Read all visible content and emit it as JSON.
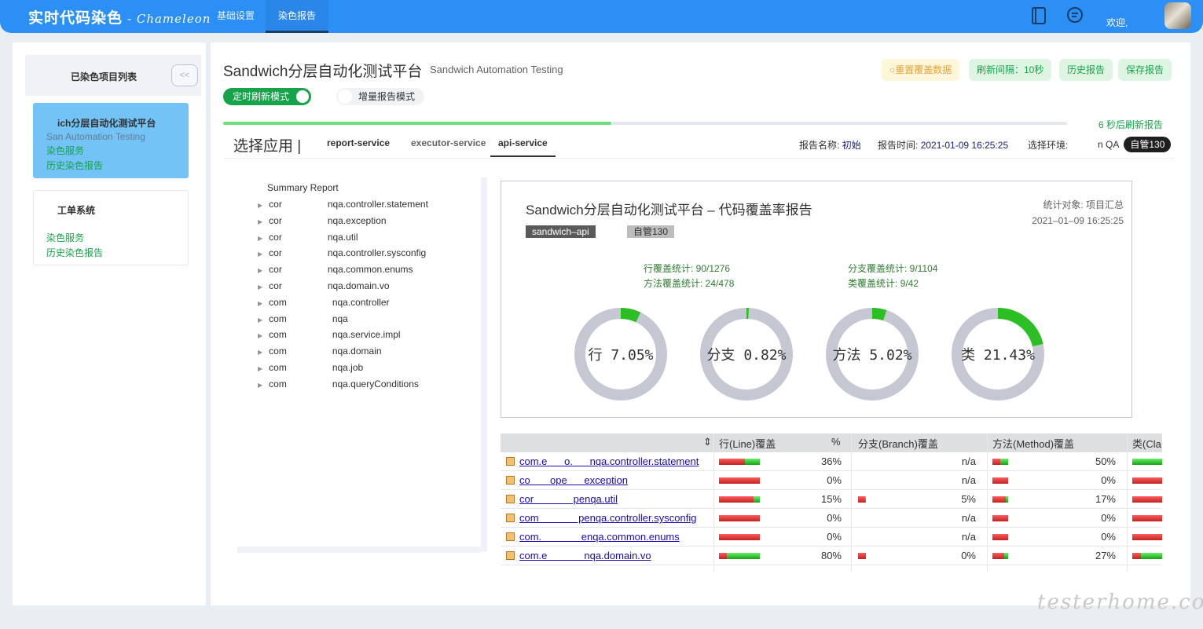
{
  "header": {
    "title": "实时代码染色",
    "subtitle": "- Chameleon",
    "nav": [
      "基础设置",
      "染色报告"
    ],
    "active_nav": "染色报告",
    "welcome": "欢迎,"
  },
  "sidebar": {
    "title": "已染色项目列表",
    "collapse_label": "<<",
    "projects": [
      {
        "name": "Sandwich分层自动化测试平台",
        "name_visible": "ich分层自动化测试平台",
        "en": "Sandwich Automation Testing",
        "en_visible": "San      Automation Testing",
        "links": [
          "染色服务",
          "历史染色报告"
        ],
        "active": true
      },
      {
        "name": "工单系统",
        "en": "",
        "links": [
          "染色服务",
          "历史染色报告"
        ],
        "active": false
      }
    ]
  },
  "main": {
    "title": "Sandwich分层自动化测试平台",
    "subtitle": "Sandwich Automation Testing",
    "buttons": {
      "reset": "重置覆盖数据",
      "interval": "刷新间隔：10秒",
      "history": "历史报告",
      "save": "保存报告"
    },
    "switches": {
      "timed": "定时刷新模式",
      "incremental": "增量报告模式"
    },
    "refresh_progress": 0.46,
    "refresh_note": "6 秒后刷新报告"
  },
  "appbar": {
    "label": "选择应用 |",
    "tabs": [
      "report-service",
      "executor-service",
      "api-service"
    ],
    "active_tab": "api-service",
    "report_name_label": "报告名称:",
    "report_name": "初始",
    "report_time_label": "报告时间:",
    "report_time": "2021-01-09 16:25:25",
    "env_label": "选择环境:",
    "env_options": [
      "n QA",
      "自管130"
    ],
    "env_selected": "自管130"
  },
  "tree": {
    "summary": "Summary Report",
    "items": [
      {
        "prefix": "cor",
        "suffix": "nqa.controller.statement"
      },
      {
        "prefix": "cor",
        "suffix": "nqa.exception"
      },
      {
        "prefix": "cor",
        "suffix": "nqa.util"
      },
      {
        "prefix": "cor",
        "suffix": "nqa.controller.sysconfig"
      },
      {
        "prefix": "cor",
        "suffix": "nqa.common.enums"
      },
      {
        "prefix": "cor",
        "suffix": "nqa.domain.vo"
      },
      {
        "prefix": "com",
        "suffix": "nqa.controller"
      },
      {
        "prefix": "com",
        "suffix": "nqa"
      },
      {
        "prefix": "com",
        "suffix": "nqa.service.impl"
      },
      {
        "prefix": "com",
        "suffix": "nqa.domain"
      },
      {
        "prefix": "com",
        "suffix": "nqa.job"
      },
      {
        "prefix": "com",
        "suffix": "nqa.queryConditions"
      }
    ]
  },
  "report_card": {
    "title": "Sandwich分层自动化测试平台 – 代码覆盖率报告",
    "target": "统计对象: 项目汇总",
    "time": "2021–01–09 16:25:25",
    "tag_app": "sandwich–api",
    "tag_env": "自管130",
    "stats": {
      "line": "行覆盖统计:  90/1276",
      "method": "方法覆盖统计:  24/478",
      "branch": "分支覆盖统计:  9/1104",
      "class": "类覆盖统计:  9/42"
    },
    "donuts": [
      {
        "label": "行 7.05%",
        "percent": 7.05
      },
      {
        "label": "分支 0.82%",
        "percent": 0.82
      },
      {
        "label": "方法 5.02%",
        "percent": 5.02
      },
      {
        "label": "类 21.43%",
        "percent": 21.43
      }
    ]
  },
  "coverage_table": {
    "headers": [
      "行(Line)覆盖",
      "%",
      "分支(Branch)覆盖",
      "方法(Method)覆盖",
      "类(Cla"
    ],
    "rows": [
      {
        "name": "com.e      o.      nqa.controller.statement",
        "line_pct": 0.36,
        "line": "36%",
        "branch_pct": null,
        "branch": "n/a",
        "method_pct": 0.5,
        "method": "50%",
        "class_pct": 1.0
      },
      {
        "name": "co       ope      exception",
        "line_pct": 0.0,
        "line": "0%",
        "branch_pct": null,
        "branch": "n/a",
        "method_pct": 0.0,
        "method": "0%",
        "class_pct": 0.0
      },
      {
        "name": "cor              penqa.util",
        "line_pct": 0.15,
        "line": "15%",
        "branch_pct": 0.05,
        "branch": "5%",
        "method_pct": 0.17,
        "method": "17%",
        "class_pct": 0.0
      },
      {
        "name": "com              penqa.controller.sysconfig",
        "line_pct": 0.0,
        "line": "0%",
        "branch_pct": null,
        "branch": "n/a",
        "method_pct": 0.0,
        "method": "0%",
        "class_pct": 0.0
      },
      {
        "name": "com.              enqa.common.enums",
        "line_pct": 0.0,
        "line": "0%",
        "branch_pct": null,
        "branch": "n/a",
        "method_pct": 0.0,
        "method": "0%",
        "class_pct": 0.0
      },
      {
        "name": "com.e             nqa.domain.vo",
        "line_pct": 0.8,
        "line": "80%",
        "branch_pct": 0.0,
        "branch": "0%",
        "method_pct": 0.27,
        "method": "27%",
        "class_pct": 0.7
      }
    ]
  },
  "colors": {
    "header": "#2b8ff5",
    "success": "#16a34a",
    "warning": "#e6a23c",
    "covered": "#2bbf24",
    "uncovered": "#c5c7d3"
  },
  "watermark": "testerhome.com"
}
